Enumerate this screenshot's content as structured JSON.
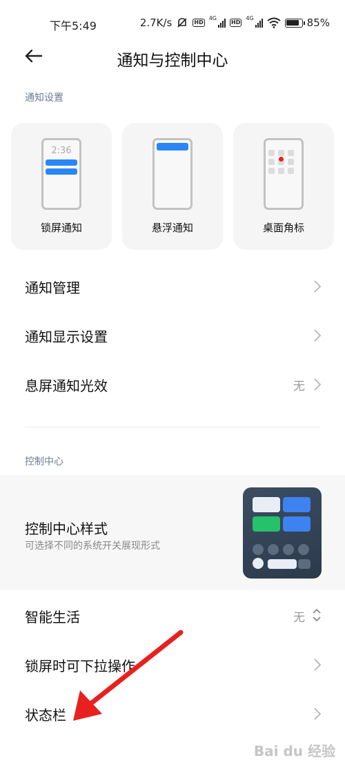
{
  "status_bar": {
    "time": "下午5:49",
    "speed": "2.7K/s",
    "battery": "85%",
    "network_label": "4G",
    "hd_label": "HD"
  },
  "header": {
    "title": "通知与控制中心"
  },
  "notification_section": {
    "label": "通知设置",
    "cards": [
      {
        "label": "锁屏通知",
        "clock": "2:36"
      },
      {
        "label": "悬浮通知"
      },
      {
        "label": "桌面角标"
      }
    ]
  },
  "notification_rows": [
    {
      "title": "通知管理",
      "value": ""
    },
    {
      "title": "通知显示设置",
      "value": ""
    },
    {
      "title": "息屏通知光效",
      "value": "无"
    }
  ],
  "control_section": {
    "label": "控制中心",
    "style_row": {
      "title": "控制中心样式",
      "subtitle": "可选择不同的系统开关展现形式"
    },
    "rows": [
      {
        "title": "智能生活",
        "value": "无"
      },
      {
        "title": "锁屏时可下拉操作",
        "value": ""
      },
      {
        "title": "状态栏",
        "value": ""
      }
    ]
  },
  "watermark": "Bai du 经验",
  "colors": {
    "accent_blue": "#2a86f5",
    "annotation_red": "#e8211f",
    "section_label": "#6b7d93"
  },
  "icons": [
    "back-arrow-icon",
    "chevron-right-icon",
    "chevron-up-down-icon",
    "wifi-icon",
    "battery-icon",
    "mute-bell-icon",
    "signal-icon"
  ]
}
